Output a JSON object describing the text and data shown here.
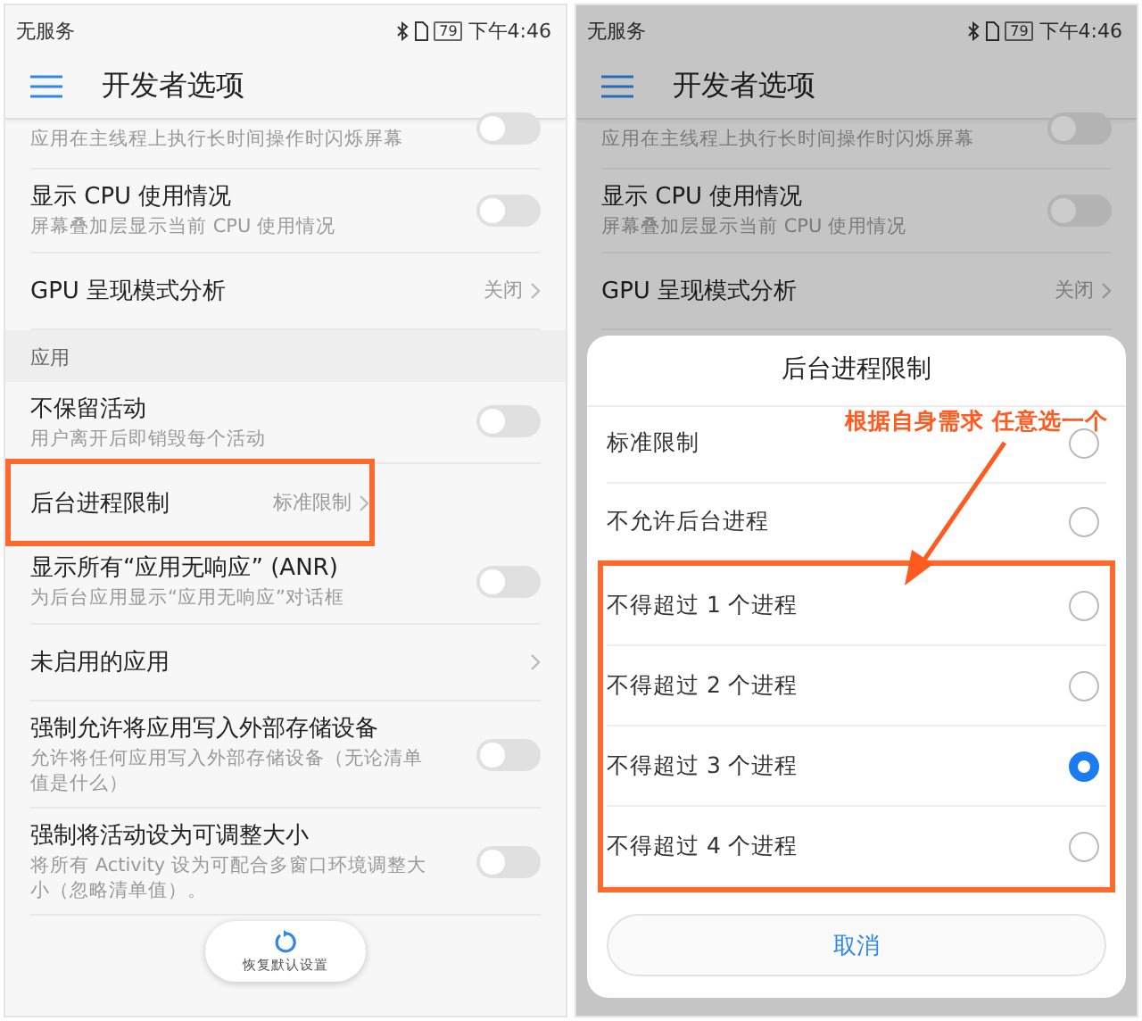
{
  "screens": [
    {
      "status_bar": {
        "carrier": "无服务",
        "battery": "79",
        "time": "下午4:46"
      },
      "header": {
        "title": "开发者选项"
      },
      "dimmed": false,
      "rows": [
        {
          "kind": "toggle",
          "subtitle": "应用在主线程上执行长时间操作时闪烁屏幕",
          "on": false,
          "highlighted": false,
          "cut": true
        },
        {
          "kind": "toggle",
          "title": "显示 CPU 使用情况",
          "subtitle": "屏幕叠加层显示当前 CPU 使用情况",
          "on": false,
          "highlighted": false
        },
        {
          "kind": "value",
          "title": "GPU 呈现模式分析",
          "value": "关闭",
          "highlighted": false
        },
        {
          "kind": "section",
          "title": "应用"
        },
        {
          "kind": "toggle",
          "title": "不保留活动",
          "subtitle": "用户离开后即销毁每个活动",
          "on": false,
          "highlighted": false
        },
        {
          "kind": "value",
          "title": "后台进程限制",
          "value": "标准限制",
          "highlighted": true
        },
        {
          "kind": "toggle",
          "title": "显示所有“应用无响应” (ANR)",
          "subtitle": "为后台应用显示“应用无响应”对话框",
          "on": false,
          "highlighted": false
        },
        {
          "kind": "value",
          "title": "未启用的应用",
          "highlighted": false
        },
        {
          "kind": "toggle",
          "title": "强制允许将应用写入外部存储设备",
          "subtitle": "允许将任何应用写入外部存储设备（无论清单值是什么）",
          "on": false,
          "highlighted": false
        },
        {
          "kind": "toggle",
          "title": "强制将活动设为可调整大小",
          "subtitle": "将所有 Activity 设为可配合多窗口环境调整大小（忽略清单值）。",
          "on": false,
          "highlighted": false
        }
      ],
      "restore_button": {
        "label": "恢复默认设置"
      }
    },
    {
      "status_bar": {
        "carrier": "无服务",
        "battery": "79",
        "time": "下午4:46"
      },
      "header": {
        "title": "开发者选项"
      },
      "dimmed": true,
      "rows": [
        {
          "kind": "toggle",
          "subtitle": "应用在主线程上执行长时间操作时闪烁屏幕",
          "on": false,
          "highlighted": false,
          "cut": true
        },
        {
          "kind": "toggle",
          "title": "显示 CPU 使用情况",
          "subtitle": "屏幕叠加层显示当前 CPU 使用情况",
          "on": false,
          "highlighted": false
        },
        {
          "kind": "value",
          "title": "GPU 呈现模式分析",
          "value": "关闭",
          "highlighted": false
        }
      ],
      "dialog": {
        "title": "后台进程限制",
        "annotation": "根据自身需求 任意选一个",
        "options": [
          {
            "label": "标准限制",
            "selected": false,
            "highlighted": false
          },
          {
            "label": "不允许后台进程",
            "selected": false,
            "highlighted": false
          },
          {
            "label": "不得超过 1 个进程",
            "selected": false,
            "highlighted": true
          },
          {
            "label": "不得超过 2 个进程",
            "selected": false,
            "highlighted": true
          },
          {
            "label": "不得超过 3 个进程",
            "selected": true,
            "highlighted": true
          },
          {
            "label": "不得超过 4 个进程",
            "selected": false,
            "highlighted": true
          }
        ],
        "cancel": "取消"
      }
    }
  ]
}
